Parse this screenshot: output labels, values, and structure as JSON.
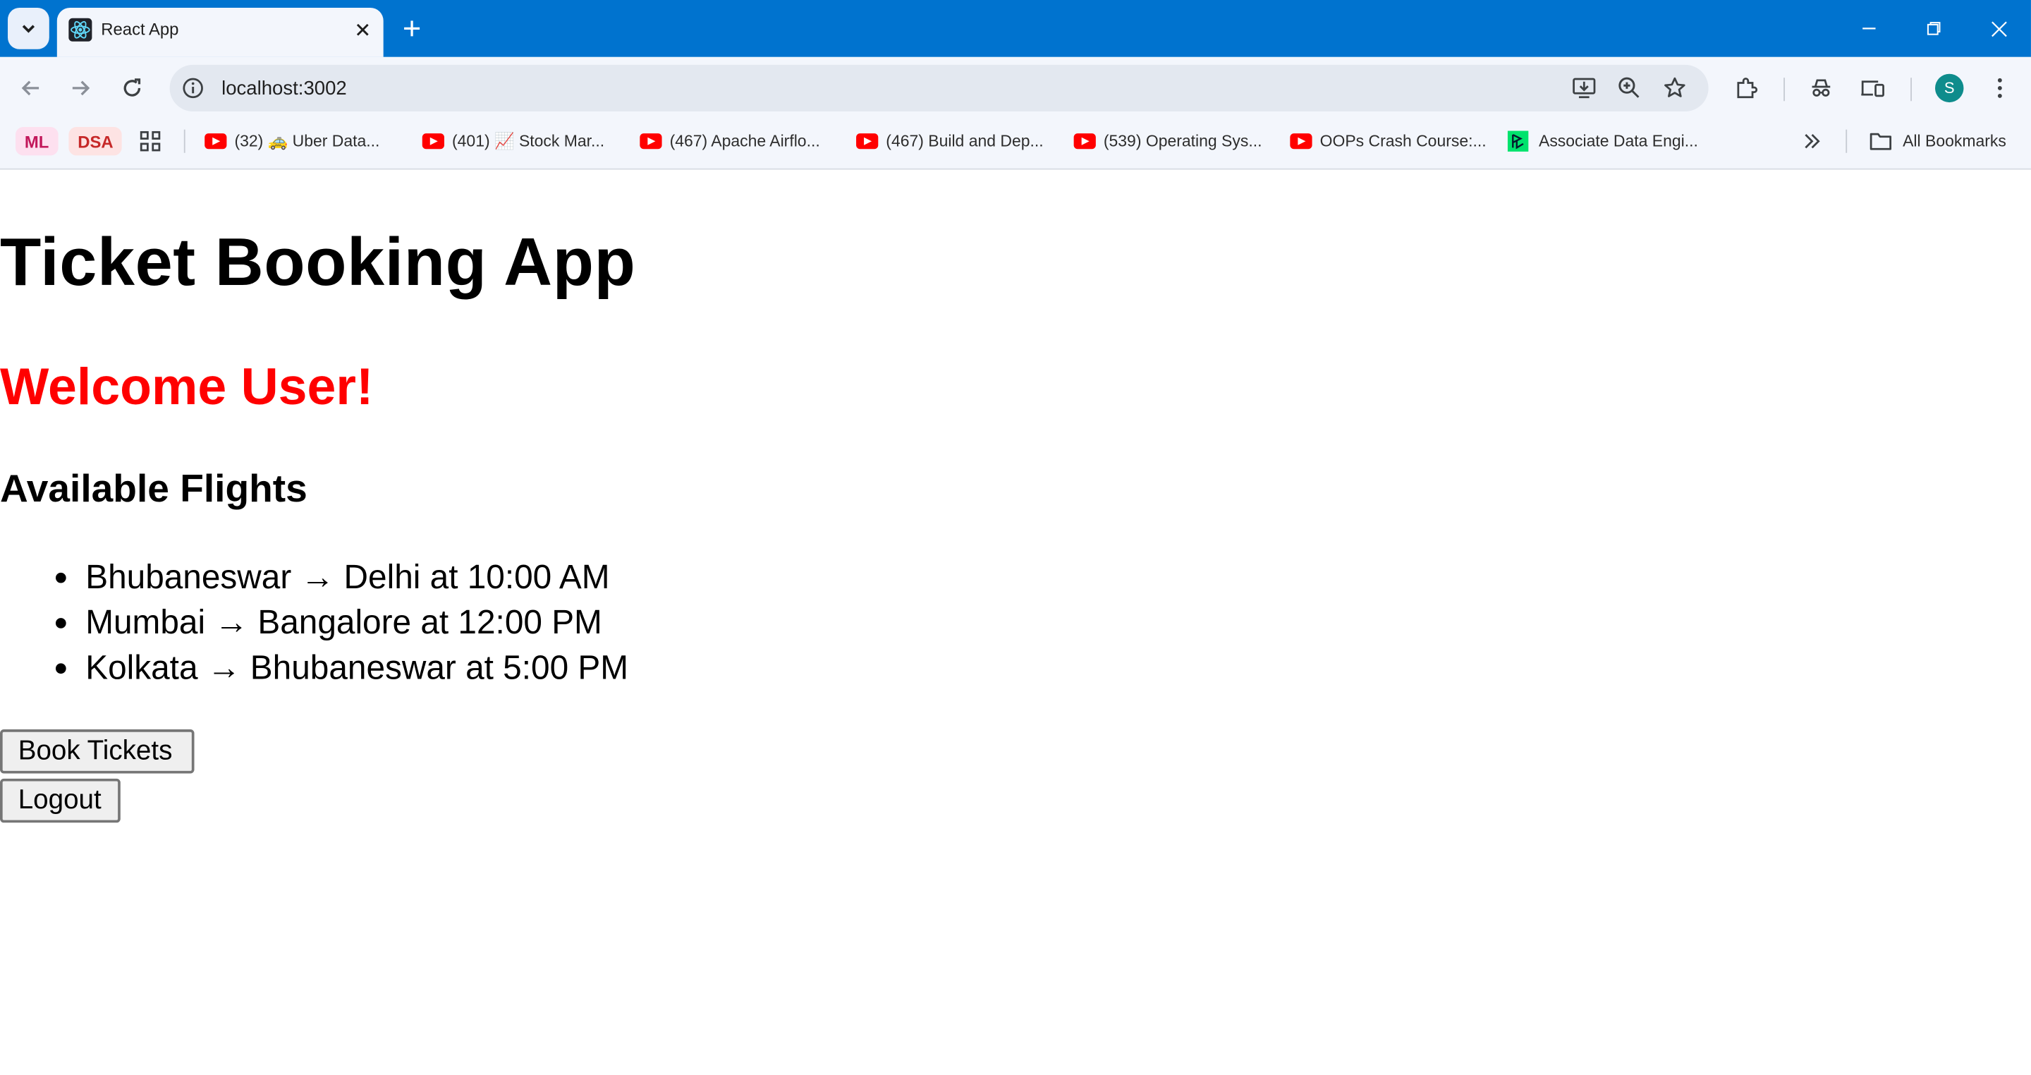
{
  "browser": {
    "tab": {
      "title": "React App"
    },
    "address_bar": {
      "url": "localhost:3002"
    },
    "profile_initial": "S",
    "bookmarks": {
      "chips": [
        {
          "label": "ML",
          "bg": "#fde0ef",
          "fg": "#c2185b"
        },
        {
          "label": "DSA",
          "bg": "#fde3e3",
          "fg": "#c62828"
        }
      ],
      "items": [
        {
          "label": "(32) 🚕 Uber Data...",
          "icon": "youtube-icon"
        },
        {
          "label": "(401) 📈 Stock Mar...",
          "icon": "youtube-icon"
        },
        {
          "label": "(467) Apache Airflo...",
          "icon": "youtube-icon"
        },
        {
          "label": "(467) Build and Dep...",
          "icon": "youtube-icon"
        },
        {
          "label": "(539) Operating Sys...",
          "icon": "youtube-icon"
        },
        {
          "label": "OOPs Crash Course:...",
          "icon": "youtube-icon"
        },
        {
          "label": "Associate Data Engi...",
          "icon": "datacamp-icon"
        }
      ],
      "all_bookmarks": "All Bookmarks"
    }
  },
  "page": {
    "title": "Ticket Booking App",
    "welcome": "Welcome User!",
    "section_heading": "Available Flights",
    "flights": [
      "Bhubaneswar → Delhi at 10:00 AM",
      "Mumbai → Bangalore at 12:00 PM",
      "Kolkata → Bhubaneswar at 5:00 PM"
    ],
    "buttons": {
      "book": "Book Tickets",
      "logout": "Logout"
    }
  },
  "colors": {
    "titlebar": "#0073cf",
    "toolbar": "#f3f6fc",
    "welcome": "#ff0000"
  }
}
